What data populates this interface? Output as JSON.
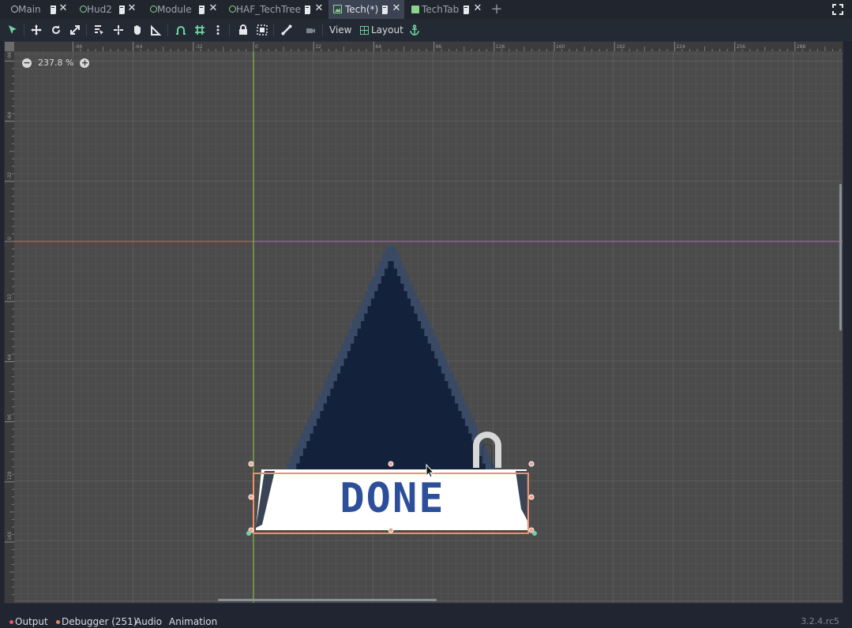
{
  "tabs": [
    {
      "label": "Main",
      "icon": "scene-icon",
      "active": false
    },
    {
      "label": "Hud2",
      "icon": "scene-icon",
      "active": false
    },
    {
      "label": "Module",
      "icon": "scene-icon",
      "active": false
    },
    {
      "label": "HAF_TechTree",
      "icon": "scene-icon",
      "active": false
    },
    {
      "label": "Tech(*)",
      "icon": "texture-rect-icon",
      "active": true
    },
    {
      "label": "TechTab",
      "icon": "panel-icon",
      "active": false
    }
  ],
  "toolbar": {
    "view_label": "View",
    "layout_label": "Layout"
  },
  "viewport": {
    "zoom_label": "237.8 %",
    "ruler_h_ticks": [
      "-96",
      "-64",
      "-32",
      "0",
      "32",
      "64",
      "96",
      "128",
      "160",
      "192",
      "224",
      "256",
      "288"
    ],
    "ruler_v_ticks": [
      "-96",
      "-64",
      "-32",
      "0",
      "32",
      "64",
      "96",
      "128",
      "160"
    ],
    "sprite_text": "DONE"
  },
  "bottom": {
    "output_label": "Output",
    "debugger_label": "Debugger (251)",
    "audio_label": "Audio",
    "animation_label": "Animation",
    "version": "3.2.4.rc5"
  },
  "colors": {
    "accent": "#6fd4a1",
    "selection": "#f0906a",
    "x_axis": "#e05d5d",
    "y_axis": "#8fcf4a",
    "sprite_dark": "#13213b",
    "sprite_mid": "#3a4a64",
    "done_blue": "#2d4f9a"
  }
}
